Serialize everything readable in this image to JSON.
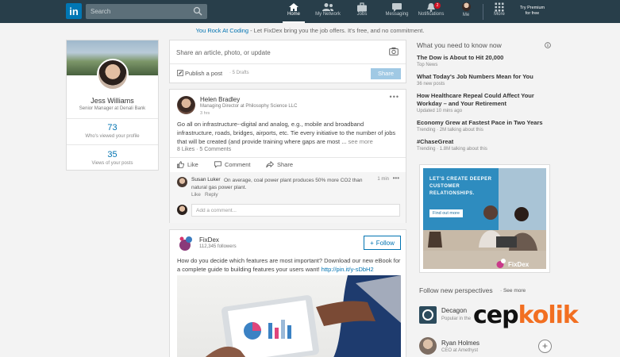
{
  "nav": {
    "logo": "in",
    "search_placeholder": "Search",
    "items": [
      {
        "label": "Home",
        "icon": "home-icon"
      },
      {
        "label": "My Network",
        "icon": "network-icon"
      },
      {
        "label": "Jobs",
        "icon": "briefcase-icon"
      },
      {
        "label": "Messaging",
        "icon": "messaging-icon"
      },
      {
        "label": "Notifications",
        "icon": "bell-icon",
        "badge": "2"
      },
      {
        "label": "Me",
        "icon": "avatar"
      },
      {
        "label": "More",
        "icon": "grid-icon"
      }
    ],
    "premium": [
      "Try Premium",
      "for free"
    ]
  },
  "promo": {
    "highlight": "You Rock At Coding",
    "text": " - Let FixDex bring you the job offers. It's free, and no commitment."
  },
  "profile": {
    "name": "Jess Williams",
    "title": "Senior Manager at Denali Bank",
    "views_count": "73",
    "views_label": "Who's viewed your profile",
    "post_views_count": "35",
    "post_views_label": "Views of your posts"
  },
  "share": {
    "placeholder": "Share an article, photo, or update",
    "publish_label": "Publish a post",
    "drafts": "· 5 Drafts",
    "share_label": "Share"
  },
  "post1": {
    "author": "Helen Bradley",
    "subtitle": "Managing Director at Philosophy Science LLC",
    "time": "3 hrs",
    "body": "Go all on infrastructure--digital and analog, e.g., mobile and broadband infrastructure, roads, bridges, airports, etc. Tie every initiative to the number of jobs that will be created (and provide training where gaps are most ...",
    "see_more": " see more",
    "stats": "8 Likes · 5 Comments",
    "actions": {
      "like": "Like",
      "comment": "Comment",
      "share": "Share"
    },
    "comment": {
      "author": "Susan Luker",
      "text": "On average, coal power plant produces 50% more CO2 than natural gas power plant.",
      "time": "1 min",
      "like": "Like",
      "reply": "Reply"
    },
    "add_comment_placeholder": "Add a comment..."
  },
  "post2": {
    "company": "FixDex",
    "followers": "112,345 followers",
    "follow_label": "Follow",
    "body": "How do you decide which features are most important? Download our new eBook for a complete guide to building features your users want! ",
    "link": "http://pin.it/y-sDbH2"
  },
  "news": {
    "header": "What you need to know now",
    "items": [
      {
        "title": "The Dow is About to Hit 20,000",
        "meta": "Top News"
      },
      {
        "title": "What Today's Job Numbers Mean for You",
        "meta": "36 new posts"
      },
      {
        "title": "How Healthcare Repeal Could Affect Your Workday – and Your Retirement",
        "meta": "Updated 10 mins ago"
      },
      {
        "title": "Economy Grew at Fastest Pace in Two Years",
        "meta": "Trending · 2M talking about this"
      },
      {
        "title": "#ChaseGreat",
        "meta": "Trending · 1.8M talking about this"
      }
    ]
  },
  "ad": {
    "headline": "LET'S CREATE DEEPER CUSTOMER RELATIONSHIPS.",
    "button": "Find out more",
    "brand": "FixDex"
  },
  "perspectives": {
    "header": "Follow new perspectives",
    "see_more": "· See more",
    "items": [
      {
        "name": "Decagon",
        "subtitle": "Popular in the"
      },
      {
        "name": "Ryan Holmes",
        "subtitle": "CEO at Amethyst"
      }
    ]
  },
  "watermark": {
    "part1": "cep",
    "part2": "kolik",
    "color1": "#111111",
    "color2": "#f26f21"
  },
  "colors": {
    "nav_bg": "#283e4a",
    "accent": "#0073b1",
    "page_bg": "#f3f3f3"
  }
}
